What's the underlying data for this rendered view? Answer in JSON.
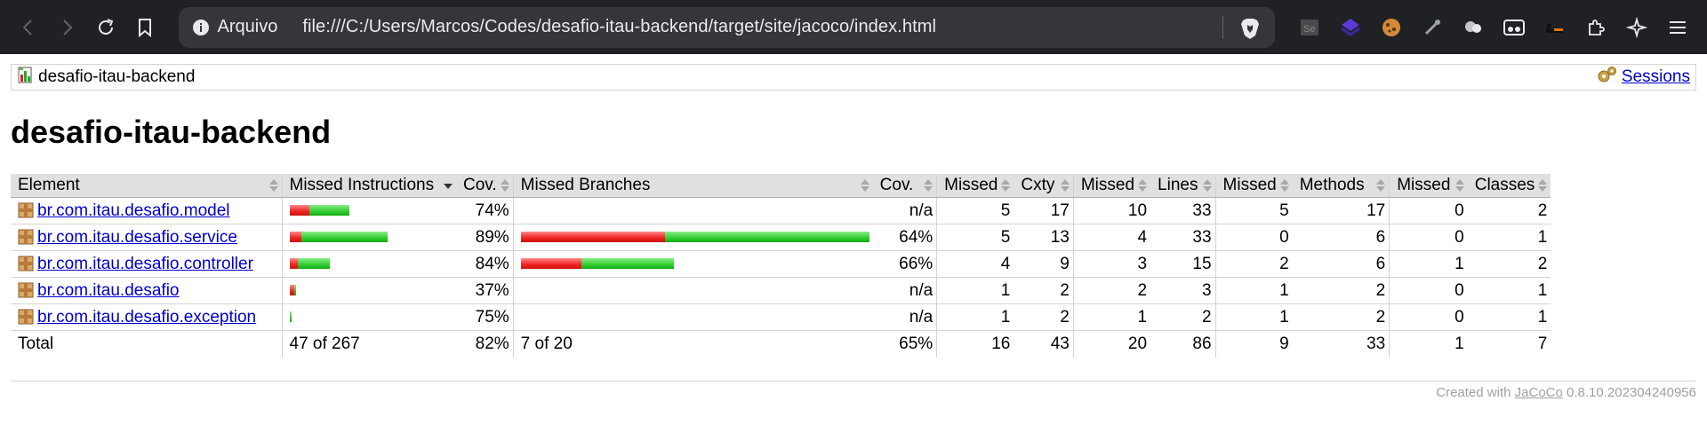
{
  "browser": {
    "site_label": "Arquivo",
    "url": "file:///C:/Users/Marcos/Codes/desafio-itau-backend/target/site/jacoco/index.html"
  },
  "breadcrumb": {
    "project": "desafio-itau-backend",
    "sessions": "Sessions"
  },
  "page": {
    "title": "desafio-itau-backend"
  },
  "table": {
    "headers": {
      "element": "Element",
      "missed_instructions": "Missed Instructions",
      "cov1": "Cov.",
      "missed_branches": "Missed Branches",
      "cov2": "Cov.",
      "missed_cxty": "Missed",
      "cxty": "Cxty",
      "missed_lines": "Missed",
      "lines": "Lines",
      "missed_methods": "Missed",
      "methods": "Methods",
      "missed_classes": "Missed",
      "classes": "Classes"
    },
    "rows": [
      {
        "name": "br.com.itau.desafio.model",
        "instr_cov": "74%",
        "branch_cov": "n/a",
        "m_cxty": "5",
        "cxty": "17",
        "m_lines": "10",
        "lines": "33",
        "m_methods": "5",
        "methods": "17",
        "m_classes": "0",
        "classes": "2",
        "instr_bar": {
          "red": 0.048,
          "green": 0.126
        },
        "branch_bar": null
      },
      {
        "name": "br.com.itau.desafio.service",
        "instr_cov": "89%",
        "branch_cov": "64%",
        "m_cxty": "5",
        "cxty": "13",
        "m_lines": "4",
        "lines": "33",
        "m_methods": "0",
        "methods": "6",
        "m_classes": "0",
        "classes": "1",
        "instr_bar": {
          "red": 0.03,
          "green": 0.27
        },
        "branch_bar": {
          "red": 0.36,
          "green": 0.64
        }
      },
      {
        "name": "br.com.itau.desafio.controller",
        "instr_cov": "84%",
        "branch_cov": "66%",
        "m_cxty": "4",
        "cxty": "9",
        "m_lines": "3",
        "lines": "15",
        "m_methods": "2",
        "methods": "6",
        "m_classes": "1",
        "classes": "2",
        "instr_bar": {
          "red": 0.019,
          "green": 0.1
        },
        "branch_bar": {
          "red": 0.15,
          "green": 0.29
        }
      },
      {
        "name": "br.com.itau.desafio",
        "instr_cov": "37%",
        "branch_cov": "n/a",
        "m_cxty": "1",
        "cxty": "2",
        "m_lines": "2",
        "lines": "3",
        "m_methods": "1",
        "methods": "2",
        "m_classes": "0",
        "classes": "1",
        "instr_bar": {
          "red": 0.01,
          "green": 0.005
        },
        "branch_bar": null
      },
      {
        "name": "br.com.itau.desafio.exception",
        "instr_cov": "75%",
        "branch_cov": "n/a",
        "m_cxty": "1",
        "cxty": "2",
        "m_lines": "1",
        "lines": "2",
        "m_methods": "1",
        "methods": "2",
        "m_classes": "0",
        "classes": "1",
        "instr_bar": {
          "red": 0.0,
          "green": 0.006
        },
        "branch_bar": null
      }
    ],
    "total": {
      "label": "Total",
      "instr": "47 of 267",
      "instr_cov": "82%",
      "branch": "7 of 20",
      "branch_cov": "65%",
      "m_cxty": "16",
      "cxty": "43",
      "m_lines": "20",
      "lines": "86",
      "m_methods": "9",
      "methods": "33",
      "m_classes": "1",
      "classes": "7"
    }
  },
  "footer": {
    "created_with": "Created with",
    "jacoco": "JaCoCo",
    "version": "0.8.10.202304240956"
  },
  "colors": {
    "chrome_bg": "#202124",
    "link": "#0000cc",
    "bar_red": "#e22222",
    "bar_green": "#33cc33"
  }
}
